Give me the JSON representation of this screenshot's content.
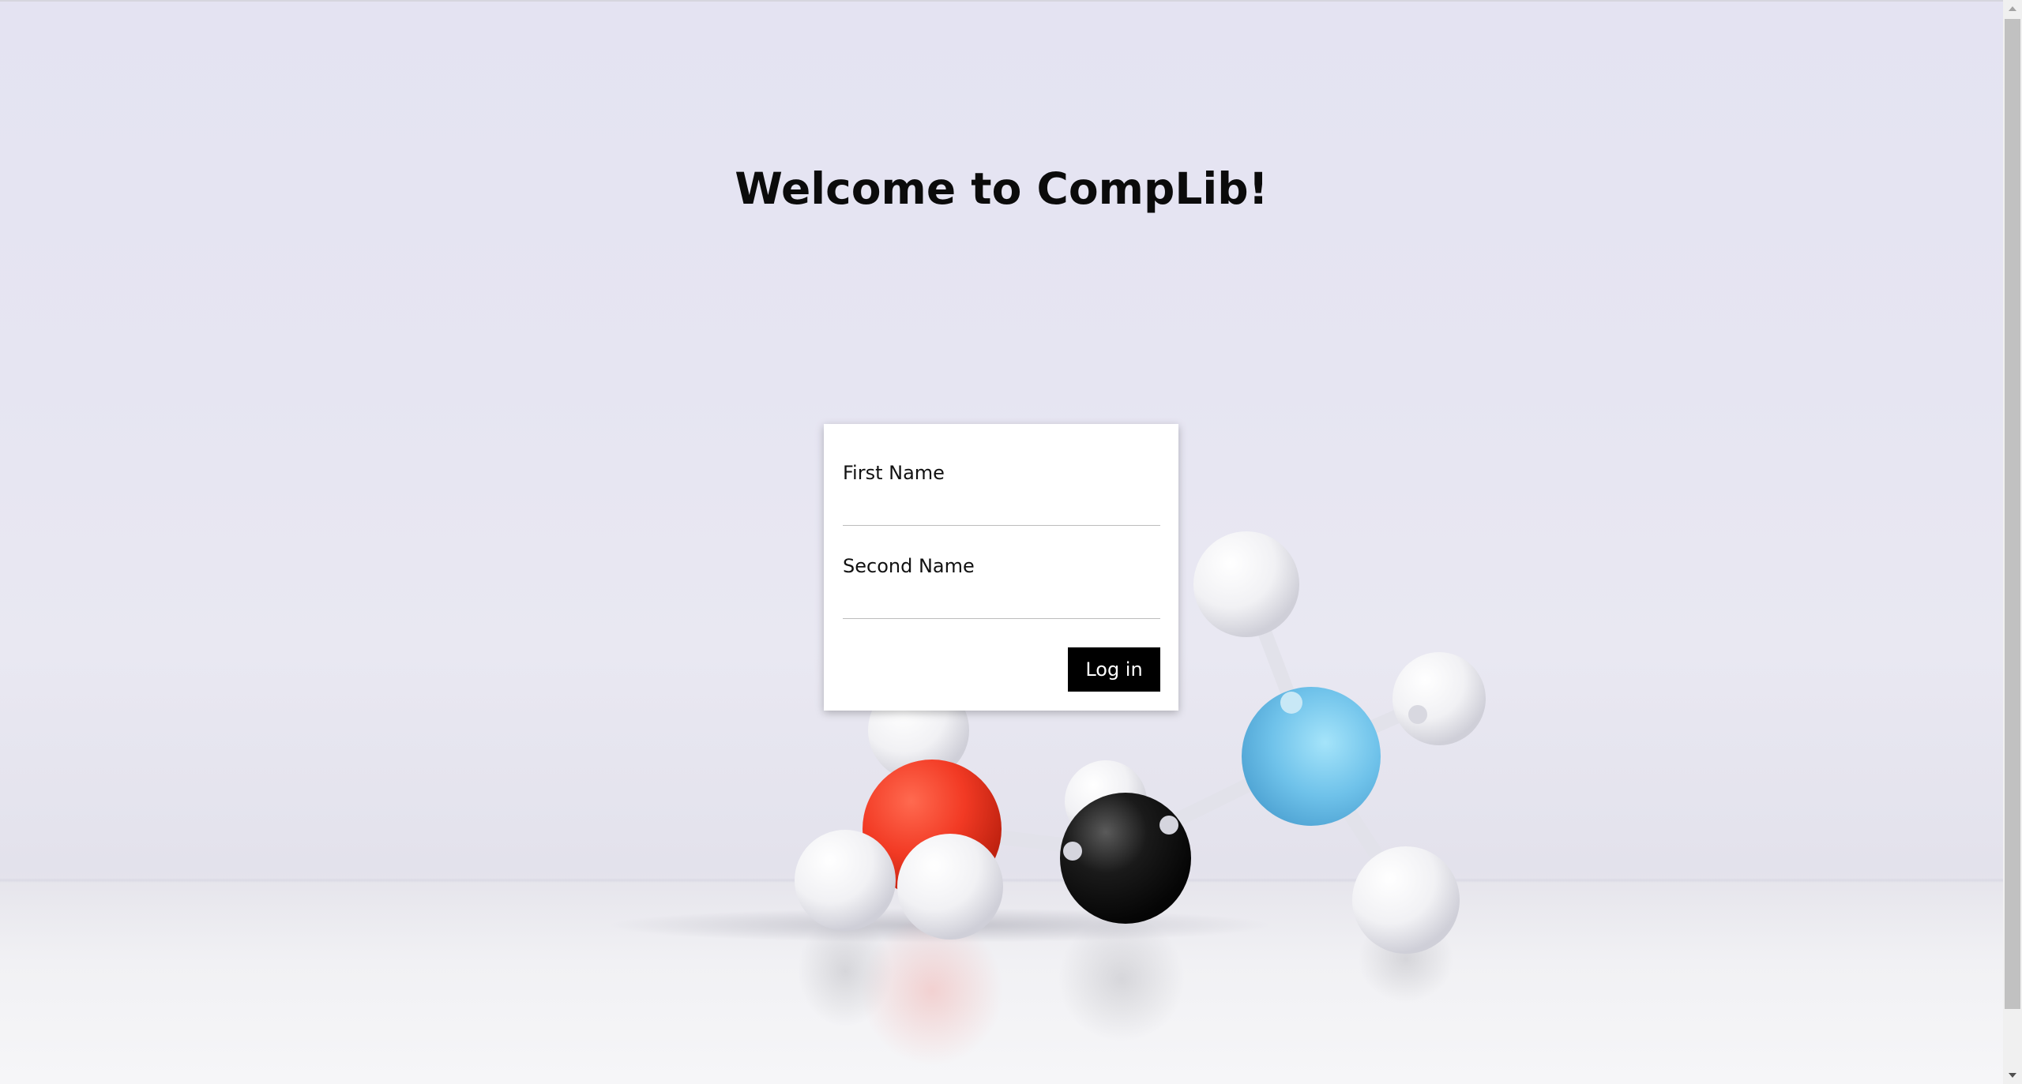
{
  "page": {
    "title": "Welcome to CompLib!"
  },
  "login_form": {
    "first_name_label": "First Name",
    "first_name_value": "",
    "second_name_label": "Second Name",
    "second_name_value": "",
    "login_button_label": "Log in"
  },
  "background": {
    "image": "molecule-model-icon",
    "atom_colors": {
      "red": "#f23a24",
      "black": "#151515",
      "blue": "#6fc2ea",
      "white": "#f4f4f6"
    }
  },
  "colors": {
    "button_bg": "#000000",
    "button_text": "#ffffff",
    "title_text": "#0b0b0b"
  }
}
